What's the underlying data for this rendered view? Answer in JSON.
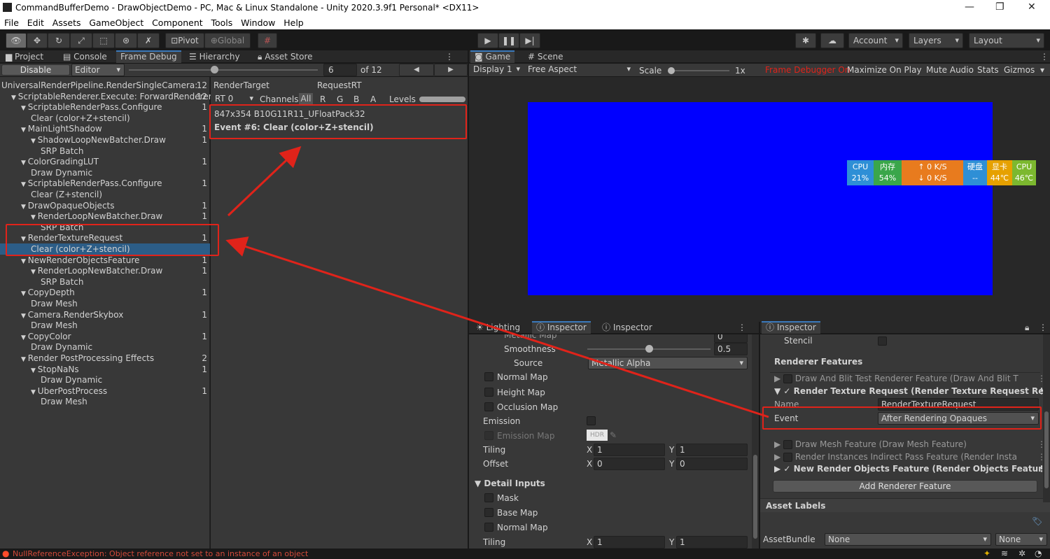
{
  "window": {
    "title": "CommandBufferDemo - DrawObjectDemo - PC, Mac & Linux Standalone - Unity 2020.3.9f1 Personal* <DX11>"
  },
  "menu": [
    "File",
    "Edit",
    "Assets",
    "GameObject",
    "Component",
    "Tools",
    "Window",
    "Help"
  ],
  "toolbar": {
    "pivot": "Pivot",
    "global": "Global",
    "account": "Account",
    "layers": "Layers",
    "layout": "Layout"
  },
  "left_tabs": [
    "Project",
    "Console",
    "Frame Debug",
    "Hierarchy",
    "Asset Store"
  ],
  "frame_debug": {
    "disable": "Disable",
    "editor": "Editor",
    "frame": "6",
    "of": "of 12",
    "render_target": "RenderTarget",
    "render_target_value": "RequestRT",
    "rt": "RT 0",
    "channels": "Channels",
    "ch": [
      "All",
      "R",
      "G",
      "B",
      "A"
    ],
    "levels": "Levels",
    "info1": "847x354 B10G11R11_UFloatPack32",
    "info2": "Event #6: Clear (color+Z+stencil)"
  },
  "tree": [
    {
      "label": "UniversalRenderPipeline.RenderSingleCamera:",
      "count": "12",
      "indent": 0,
      "arrow": ""
    },
    {
      "label": "ScriptableRenderer.Execute: ForwardRenderer",
      "count": "12",
      "indent": 1,
      "arrow": "▼"
    },
    {
      "label": "ScriptableRenderPass.Configure",
      "count": "1",
      "indent": 2,
      "arrow": "▼"
    },
    {
      "label": "Clear (color+Z+stencil)",
      "count": "",
      "indent": 3,
      "arrow": ""
    },
    {
      "label": "MainLightShadow",
      "count": "1",
      "indent": 2,
      "arrow": "▼"
    },
    {
      "label": "ShadowLoopNewBatcher.Draw",
      "count": "1",
      "indent": 3,
      "arrow": "▼"
    },
    {
      "label": "SRP Batch",
      "count": "",
      "indent": 4,
      "arrow": ""
    },
    {
      "label": "ColorGradingLUT",
      "count": "1",
      "indent": 2,
      "arrow": "▼"
    },
    {
      "label": "Draw Dynamic",
      "count": "",
      "indent": 3,
      "arrow": ""
    },
    {
      "label": "ScriptableRenderPass.Configure",
      "count": "1",
      "indent": 2,
      "arrow": "▼"
    },
    {
      "label": "Clear (Z+stencil)",
      "count": "",
      "indent": 3,
      "arrow": ""
    },
    {
      "label": "DrawOpaqueObjects",
      "count": "1",
      "indent": 2,
      "arrow": "▼"
    },
    {
      "label": "RenderLoopNewBatcher.Draw",
      "count": "1",
      "indent": 3,
      "arrow": "▼"
    },
    {
      "label": "SRP Batch",
      "count": "",
      "indent": 4,
      "arrow": ""
    },
    {
      "label": "RenderTextureRequest",
      "count": "1",
      "indent": 2,
      "arrow": "▼"
    },
    {
      "label": "Clear (color+Z+stencil)",
      "count": "",
      "indent": 3,
      "arrow": "",
      "selected": true
    },
    {
      "label": "NewRenderObjectsFeature",
      "count": "1",
      "indent": 2,
      "arrow": "▼"
    },
    {
      "label": "RenderLoopNewBatcher.Draw",
      "count": "1",
      "indent": 3,
      "arrow": "▼"
    },
    {
      "label": "SRP Batch",
      "count": "",
      "indent": 4,
      "arrow": ""
    },
    {
      "label": "CopyDepth",
      "count": "1",
      "indent": 2,
      "arrow": "▼"
    },
    {
      "label": "Draw Mesh",
      "count": "",
      "indent": 3,
      "arrow": ""
    },
    {
      "label": "Camera.RenderSkybox",
      "count": "1",
      "indent": 2,
      "arrow": "▼"
    },
    {
      "label": "Draw Mesh",
      "count": "",
      "indent": 3,
      "arrow": ""
    },
    {
      "label": "CopyColor",
      "count": "1",
      "indent": 2,
      "arrow": "▼"
    },
    {
      "label": "Draw Dynamic",
      "count": "",
      "indent": 3,
      "arrow": ""
    },
    {
      "label": "Render PostProcessing Effects",
      "count": "2",
      "indent": 2,
      "arrow": "▼"
    },
    {
      "label": "StopNaNs",
      "count": "1",
      "indent": 3,
      "arrow": "▼"
    },
    {
      "label": "Draw Dynamic",
      "count": "",
      "indent": 4,
      "arrow": ""
    },
    {
      "label": "UberPostProcess",
      "count": "1",
      "indent": 3,
      "arrow": "▼"
    },
    {
      "label": "Draw Mesh",
      "count": "",
      "indent": 4,
      "arrow": ""
    }
  ],
  "game": {
    "tabs": [
      "Game",
      "Scene"
    ],
    "display": "Display 1",
    "aspect": "Free Aspect",
    "scale": "Scale",
    "scale_value": "1x",
    "frame_debugger_on": "Frame Debugger On",
    "maximize": "Maximize On Play",
    "mute": "Mute Audio",
    "stats": "Stats",
    "gizmos": "Gizmos",
    "viewport_color": "#0000ff"
  },
  "monitor": [
    {
      "top": "CPU",
      "bot": "21%",
      "color": "#2e8fd6"
    },
    {
      "top": "内存",
      "bot": "54%",
      "color": "#3aa64a"
    },
    {
      "top": "↑ 0 K/S",
      "bot": "↓ 0 K/S",
      "color": "#e87b1e"
    },
    {
      "top": "硬盘",
      "bot": "--",
      "color": "#2e8fd6"
    },
    {
      "top": "显卡",
      "bot": "44℃",
      "color": "#e6a100"
    },
    {
      "top": "CPU",
      "bot": "46℃",
      "color": "#7cb82f"
    }
  ],
  "mid_inspector": {
    "tabs": [
      "Lighting",
      "Inspector",
      "Inspector"
    ],
    "cut_label": "Metallic Map",
    "cut_value": "0",
    "smoothness": "Smoothness",
    "smoothness_value": "0.5",
    "source": "Source",
    "source_value": "Metallic Alpha",
    "normal_map": "Normal Map",
    "height_map": "Height Map",
    "occlusion_map": "Occlusion Map",
    "emission": "Emission",
    "emission_map": "Emission Map",
    "hdr": "HDR",
    "tiling": "Tiling",
    "offset": "Offset",
    "x_label": "X",
    "y_label": "Y",
    "tiling_x": "1",
    "tiling_y": "1",
    "offset_x": "0",
    "offset_y": "0",
    "detail_inputs": "Detail Inputs",
    "mask": "Mask",
    "base_map": "Base Map",
    "normal_map2": "Normal Map",
    "tiling2": "Tiling",
    "tiling2_x": "1",
    "tiling2_y": "1"
  },
  "right_inspector": {
    "tab": "Inspector",
    "stencil": "Stencil",
    "renderer_features": "Renderer Features",
    "features": [
      {
        "label": "Draw And Blit Test Renderer Feature (Draw And Blit T",
        "checked": false
      },
      {
        "label": "Render Texture Request (Render Texture Request Re",
        "checked": true
      }
    ],
    "name_label": "Name",
    "name_value": "RenderTextureRequest",
    "event_label": "Event",
    "event_value": "After Rendering Opaques",
    "features2": [
      {
        "label": "Draw Mesh Feature (Draw Mesh Feature)",
        "checked": false
      },
      {
        "label": "Render Instances Indirect Pass Feature (Render Insta",
        "checked": false
      },
      {
        "label": "New Render Objects Feature (Render Objects Featur",
        "checked": true
      }
    ],
    "add_feature": "Add Renderer Feature",
    "asset_labels": "Asset Labels",
    "assetbundle": "AssetBundle",
    "none1": "None",
    "none2": "None"
  },
  "status": {
    "error": "NullReferenceException: Object reference not set to an instance of an object"
  }
}
